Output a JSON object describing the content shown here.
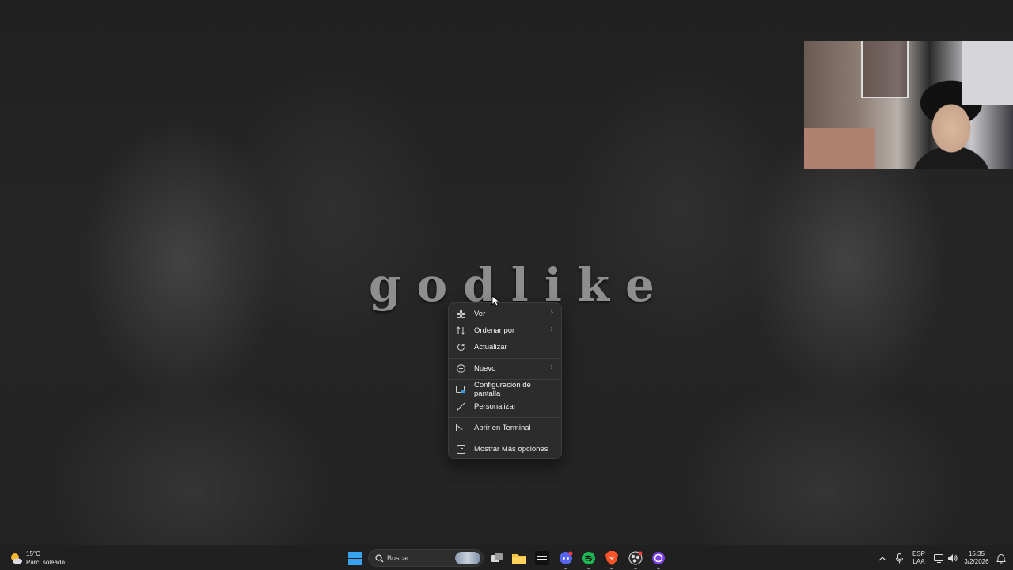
{
  "wallpaper": {
    "text": "godlike"
  },
  "context_menu": {
    "items": [
      {
        "label": "Ver",
        "icon": "grid-view-icon",
        "has_submenu": true
      },
      {
        "label": "Ordenar por",
        "icon": "sort-icon",
        "has_submenu": true
      },
      {
        "label": "Actualizar",
        "icon": "refresh-icon",
        "has_submenu": false
      },
      {
        "label": "Nuevo",
        "icon": "new-plus-icon",
        "has_submenu": true
      },
      {
        "label": "Configuración de pantalla",
        "icon": "display-settings-icon",
        "has_submenu": false
      },
      {
        "label": "Personalizar",
        "icon": "brush-icon",
        "has_submenu": false
      },
      {
        "label": "Abrir en Terminal",
        "icon": "terminal-icon",
        "has_submenu": false
      },
      {
        "label": "Mostrar Más opciones",
        "icon": "more-options-icon",
        "has_submenu": false
      }
    ]
  },
  "taskbar": {
    "weather": {
      "temp": "15°C",
      "condition": "Parc. soleado",
      "icon": "partly-sunny-icon"
    },
    "search": {
      "label": "Buscar"
    },
    "apps": [
      "start-icon",
      "task-view-icon",
      "file-explorer-icon",
      "call-of-duty-icon",
      "discord-icon",
      "spotify-icon",
      "brave-icon",
      "obs-icon",
      "app-circle-icon"
    ],
    "tray": {
      "language_top": "ESP",
      "language_bottom": "LAA",
      "time": "15:35",
      "date": "3/2/2026"
    }
  },
  "colors": {
    "menu_bg": "#2c2c2c",
    "taskbar_bg": "#202020",
    "spotify": "#1db954",
    "discord": "#5865f2",
    "brave": "#fb542b",
    "accent": "#0078d4"
  }
}
